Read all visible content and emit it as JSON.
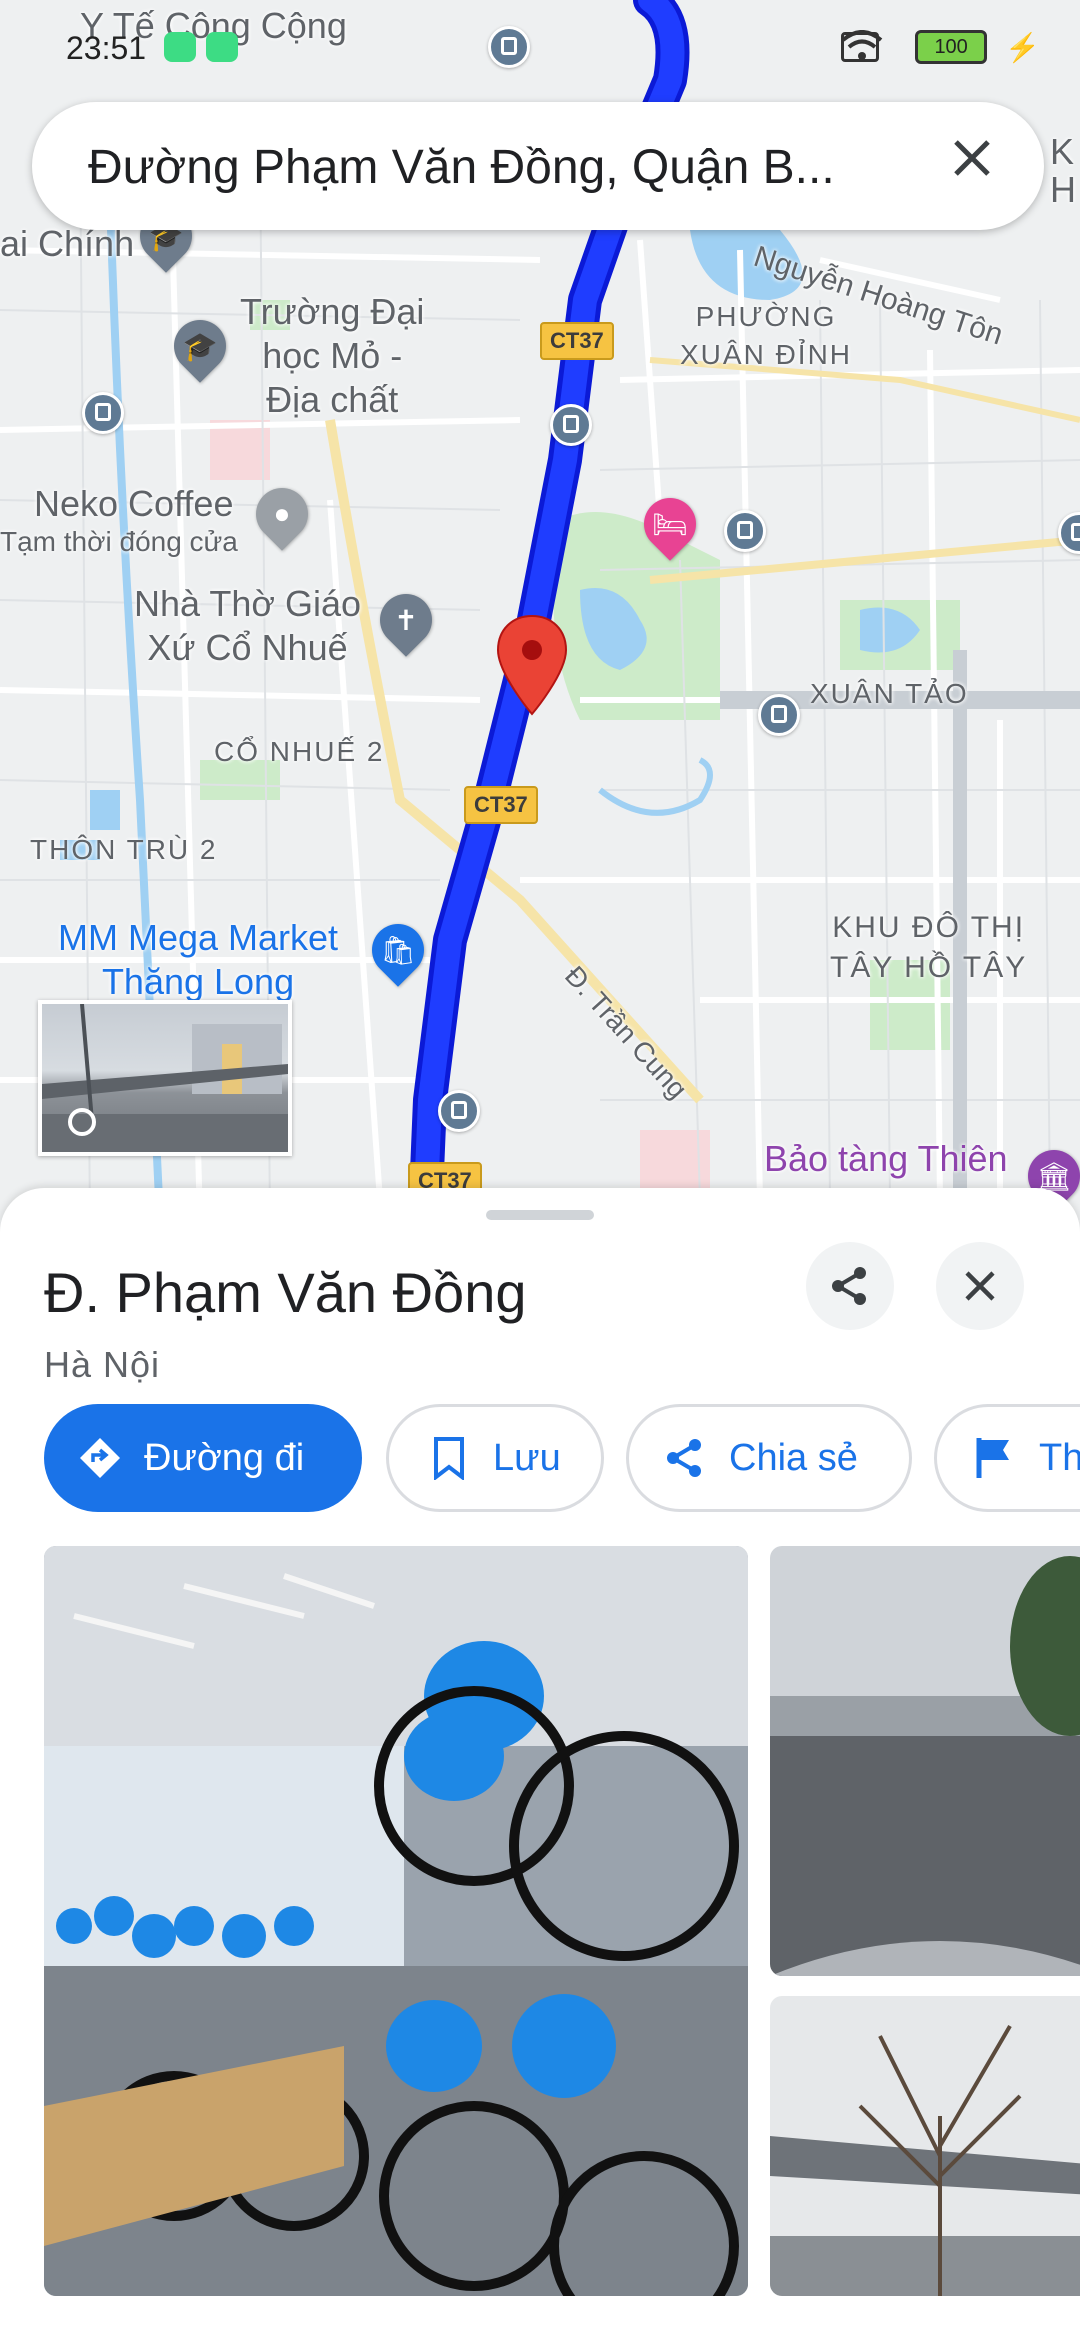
{
  "status_bar": {
    "time": "23:51",
    "battery": "100"
  },
  "search": {
    "query": "Đường Phạm Văn Đồng, Quận B..."
  },
  "map": {
    "labels": {
      "y_te": "Y Tế Công Cộng",
      "tai_chinh": "ai Chính",
      "truong_dai_hoc": "Trường Đại\nhọc Mỏ -\nĐịa chất",
      "neko": "Neko Coffee",
      "neko_status": "Tạm thời đóng cửa",
      "nha_tho": "Nhà Thờ Giáo\nXứ Cổ Nhuế",
      "co_nhue": "CỔ NHUẾ 2",
      "thon_tru": "THÔN TRÙ 2",
      "mm_mega": "MM Mega Market\nThăng Long",
      "phuong_xuan_dinh": "PHƯỜNG\nXUÂN ĐỈNH",
      "nguyen_hoang_ton": "Nguyễn Hoàng Tôn",
      "xuan_tao": "XUÂN TẢO",
      "khu_do_thi": "KHU ĐÔ THỊ\nTÂY HỒ TÂY",
      "tran_cung": "Đ. Trần Cung",
      "bao_tang": "Bảo tàng Thiên",
      "edge_k": "K",
      "edge_h": "H"
    },
    "road_shields": [
      "CT37",
      "CT37",
      "CT37"
    ]
  },
  "place": {
    "title": "Đ. Phạm Văn Đồng",
    "subtitle": "Hà Nội"
  },
  "actions": {
    "directions": "Đường đi",
    "save": "Lưu",
    "share": "Chia sẻ",
    "flag": "Th"
  },
  "colors": {
    "route": "#1a2cf0",
    "accent": "#1a73e8",
    "pin": "#ea4335"
  }
}
